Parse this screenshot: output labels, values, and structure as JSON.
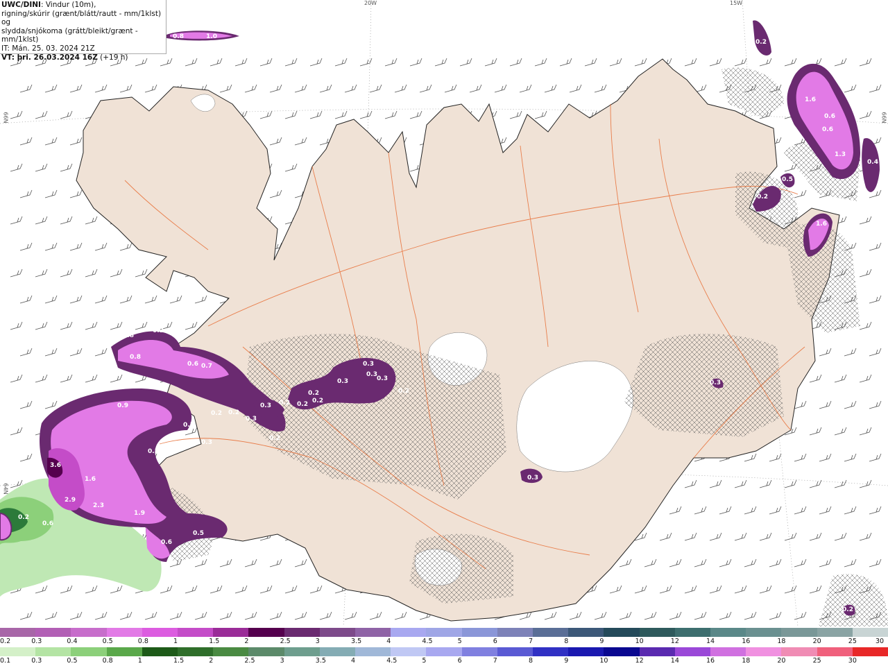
{
  "title": {
    "model": "UWC/DINI",
    "line1": ": Vindur (10m),",
    "line2": "rigning/skúrir (grænt/blátt/rautt - mm/1klst) og",
    "line3": "slydda/snjókoma (grátt/bleikt/grænt - mm/1klst)",
    "it": "IT: Mán. 25. 03. 2024 21Z",
    "vt_prefix": "VT:",
    "vt": " þri. 26.03.2024 16Z",
    "vt_suffix": " (+19 h)"
  },
  "grid_labels": {
    "lon20": "20W",
    "lon15": "15W",
    "lat66_left": "66N",
    "lat66_right": "66N",
    "lat64": "64N"
  },
  "colors": {
    "land": "#f0e2d6",
    "sea": "#ffffff",
    "roads": "#e8733c",
    "snow_light": "#e066e0",
    "snow_mid": "#b04cb4",
    "snow_dark": "#6a2a70",
    "rain_light": "#bfe8b4",
    "rain_dark": "#2c7a3a"
  },
  "snow_legend": {
    "labels": [
      "0.2",
      "0.3",
      "0.4",
      "0.5",
      "0.8",
      "1",
      "1.5",
      "2",
      "2.5",
      "3",
      "3.5",
      "4",
      "4.5",
      "5",
      "6",
      "7",
      "8",
      "9",
      "10",
      "12",
      "14",
      "16",
      "18",
      "20",
      "25",
      "30"
    ],
    "colors": [
      "#a866a8",
      "#b25fb5",
      "#c76dcb",
      "#e27ae6",
      "#dc5ce0",
      "#c44cc8",
      "#9a2c98",
      "#55004e",
      "#6a2a70",
      "#7d4a8a",
      "#8f63a6",
      "#a8a8f0",
      "#9fa6e6",
      "#8a96d8",
      "#7d82b8",
      "#5a6e96",
      "#3c5878",
      "#244a5a",
      "#2e5a5c",
      "#3d6e6e",
      "#5a8888",
      "#6a9090",
      "#7a9898",
      "#8aa4a4",
      "#c8d4d4"
    ]
  },
  "rain_legend": {
    "labels": [
      "0.1",
      "0.3",
      "0.5",
      "0.8",
      "1",
      "1.5",
      "2",
      "2.5",
      "3",
      "3.5",
      "4",
      "4.5",
      "5",
      "6",
      "7",
      "8",
      "9",
      "10",
      "12",
      "14",
      "16",
      "18",
      "20",
      "25",
      "30"
    ],
    "colors": [
      "#d4f0c8",
      "#b4e4a4",
      "#8cd07a",
      "#5aa84a",
      "#1d5a18",
      "#2f6e2a",
      "#4a8a42",
      "#5c8a6a",
      "#6e9e8e",
      "#84acb4",
      "#a0b8d8",
      "#c0c8f4",
      "#a8a8f0",
      "#8080e0",
      "#5a5ad4",
      "#3030c4",
      "#1a18b0",
      "#0a0890",
      "#5a2ab0",
      "#9a48d8",
      "#d070e0",
      "#f090e0",
      "#f08cb4",
      "#f0607c",
      "#e82828"
    ]
  },
  "snow_values": [
    "0.8",
    "1.0",
    "0.2",
    "1.6",
    "0.6",
    "0.6",
    "1.3",
    "0.4",
    "0.5",
    "0.2",
    "1.6",
    "0.2",
    "0.8",
    "0.8",
    "0.6",
    "0.7",
    "0.3",
    "0.3",
    "0.3",
    "0.3",
    "0.2",
    "0.3",
    "0.2",
    "0.2",
    "0.2",
    "0.3",
    "0.2",
    "0.2",
    "0.3",
    "0.9",
    "0.5",
    "0.3",
    "0.3",
    "3.6",
    "1.6",
    "2.9",
    "2.3",
    "1.9",
    "0.6",
    "0.5",
    "0.3",
    "0.2",
    "0.2",
    "0.2"
  ],
  "rain_values": [
    "0.2",
    "0.6"
  ]
}
